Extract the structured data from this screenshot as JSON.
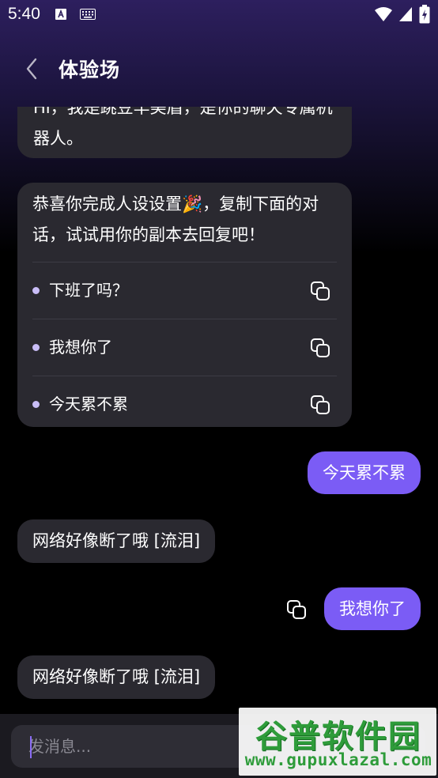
{
  "status_bar": {
    "time": "5:40"
  },
  "header": {
    "title": "体验场"
  },
  "chat": {
    "intro": "Hi，我是跳豆羊美眉，是你的聊天专属机器人。",
    "suggestion_card": {
      "text": "恭喜你完成人设设置🎉，复制下面的对话，试试用你的副本去回复吧！",
      "items": [
        {
          "label": "下班了吗？"
        },
        {
          "label": "我想你了"
        },
        {
          "label": "今天累不累"
        }
      ]
    },
    "messages": [
      {
        "from": "user",
        "text": "今天累不累"
      },
      {
        "from": "bot",
        "text": "网络好像断了哦 [流泪]"
      },
      {
        "from": "user",
        "text": "我想你了"
      },
      {
        "from": "bot",
        "text": "网络好像断了哦 [流泪]"
      }
    ]
  },
  "input": {
    "placeholder": "发消息..."
  },
  "watermark": {
    "title": "谷普软件园",
    "url": "www.gupuxlazal.com"
  },
  "colors": {
    "accent": "#7b5cf5",
    "bot_bubble": "#2a2930",
    "background": "#000000"
  }
}
